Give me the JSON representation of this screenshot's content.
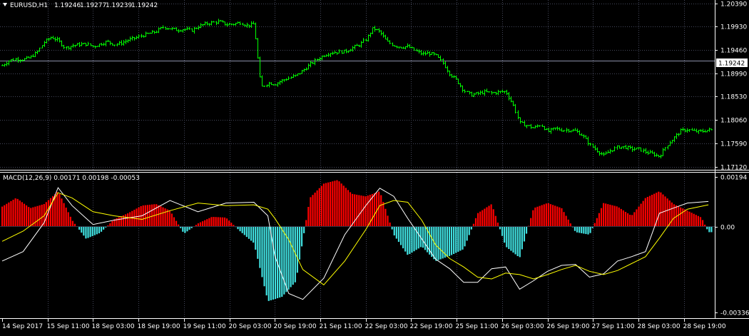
{
  "chart_data": [
    {
      "type": "bar",
      "title": "EURUSD,H1",
      "ohlc": [
        "1.19246",
        "1.19277",
        "1.19239",
        "1.19242"
      ],
      "current_price_label": "1.19242",
      "ylim": [
        1.1712,
        1.2039
      ],
      "y_ticks": [
        "1.20390",
        "1.19930",
        "1.19460",
        "1.18990",
        "1.18530",
        "1.18060",
        "1.17590",
        "1.17120"
      ],
      "colors": {
        "bars": "#00ff00",
        "grid": "#44475a",
        "price_line": "#8a8fa8"
      },
      "price_path": [
        [
          0,
          1.1915
        ],
        [
          1,
          1.1925
        ],
        [
          2,
          1.1928
        ],
        [
          3,
          1.1927
        ],
        [
          4,
          1.1931
        ],
        [
          5,
          1.1942
        ],
        [
          6,
          1.1962
        ],
        [
          7,
          1.1972
        ],
        [
          8,
          1.1965
        ],
        [
          9,
          1.195
        ],
        [
          10,
          1.1955
        ],
        [
          11,
          1.1957
        ],
        [
          12,
          1.1958
        ],
        [
          13,
          1.1953
        ],
        [
          14,
          1.1958
        ],
        [
          15,
          1.1963
        ],
        [
          16,
          1.1957
        ],
        [
          17,
          1.196
        ],
        [
          18,
          1.1966
        ],
        [
          19,
          1.197
        ],
        [
          20,
          1.1975
        ],
        [
          21,
          1.1979
        ],
        [
          22,
          1.1983
        ],
        [
          23,
          1.1992
        ],
        [
          24,
          1.1989
        ],
        [
          25,
          1.1986
        ],
        [
          26,
          1.1988
        ],
        [
          27,
          1.1985
        ],
        [
          28,
          1.1993
        ],
        [
          29,
          1.1998
        ],
        [
          30,
          1.2001
        ],
        [
          31,
          1.2003
        ],
        [
          32,
          1.1997
        ],
        [
          33,
          1.1998
        ],
        [
          34,
          1.2001
        ],
        [
          35,
          1.1995
        ],
        [
          36,
          1.1998
        ],
        [
          37,
          1.1871
        ],
        [
          38,
          1.188
        ],
        [
          39,
          1.1878
        ],
        [
          40,
          1.1885
        ],
        [
          41,
          1.189
        ],
        [
          42,
          1.1895
        ],
        [
          43,
          1.1905
        ],
        [
          44,
          1.1917
        ],
        [
          45,
          1.1927
        ],
        [
          46,
          1.1936
        ],
        [
          47,
          1.1941
        ],
        [
          48,
          1.1942
        ],
        [
          49,
          1.1943
        ],
        [
          50,
          1.195
        ],
        [
          51,
          1.1956
        ],
        [
          52,
          1.1967
        ],
        [
          53,
          1.199
        ],
        [
          54,
          1.1982
        ],
        [
          55,
          1.1963
        ],
        [
          56,
          1.1955
        ],
        [
          57,
          1.1952
        ],
        [
          58,
          1.1953
        ],
        [
          59,
          1.1945
        ],
        [
          60,
          1.1938
        ],
        [
          61,
          1.194
        ],
        [
          62,
          1.1935
        ],
        [
          63,
          1.192
        ],
        [
          64,
          1.1898
        ],
        [
          65,
          1.1885
        ],
        [
          66,
          1.1865
        ],
        [
          67,
          1.1856
        ],
        [
          68,
          1.1859
        ],
        [
          69,
          1.1862
        ],
        [
          70,
          1.186
        ],
        [
          71,
          1.1862
        ],
        [
          72,
          1.1863
        ],
        [
          73,
          1.1838
        ],
        [
          74,
          1.18
        ],
        [
          75,
          1.1795
        ],
        [
          76,
          1.179
        ],
        [
          77,
          1.1797
        ],
        [
          78,
          1.1782
        ],
        [
          79,
          1.1789
        ],
        [
          80,
          1.1786
        ],
        [
          81,
          1.1786
        ],
        [
          82,
          1.1784
        ],
        [
          83,
          1.1775
        ],
        [
          84,
          1.1757
        ],
        [
          85,
          1.1745
        ],
        [
          86,
          1.1735
        ],
        [
          87,
          1.1745
        ],
        [
          88,
          1.1752
        ],
        [
          89,
          1.1752
        ],
        [
          90,
          1.1748
        ],
        [
          91,
          1.1748
        ],
        [
          92,
          1.1742
        ],
        [
          93,
          1.1738
        ],
        [
          94,
          1.1733
        ],
        [
          95,
          1.1755
        ],
        [
          96,
          1.177
        ],
        [
          97,
          1.1784
        ],
        [
          98,
          1.1787
        ],
        [
          99,
          1.1783
        ],
        [
          100,
          1.1783
        ],
        [
          101,
          1.1786
        ]
      ],
      "x": [
        {
          "label": "14 Sep 2017",
          "pos": 0
        },
        {
          "label": "15 Sep 11:00",
          "pos": 6.5
        },
        {
          "label": "18 Sep 03:00",
          "pos": 13.0
        },
        {
          "label": "18 Sep 19:00",
          "pos": 19.5
        },
        {
          "label": "19 Sep 11:00",
          "pos": 26.0
        },
        {
          "label": "20 Sep 03:00",
          "pos": 32.5
        },
        {
          "label": "20 Sep 19:00",
          "pos": 39.0
        },
        {
          "label": "21 Sep 11:00",
          "pos": 45.5
        },
        {
          "label": "22 Sep 03:00",
          "pos": 52.0
        },
        {
          "label": "22 Sep 19:00",
          "pos": 58.5
        },
        {
          "label": "25 Sep 11:00",
          "pos": 65.0
        },
        {
          "label": "26 Sep 03:00",
          "pos": 71.5
        },
        {
          "label": "26 Sep 19:00",
          "pos": 78.0
        },
        {
          "label": "27 Sep 11:00",
          "pos": 84.5
        },
        {
          "label": "28 Sep 03:00",
          "pos": 91.0
        },
        {
          "label": "28 Sep 19:00",
          "pos": 97.5
        }
      ],
      "xlim": [
        0,
        101.5
      ]
    },
    {
      "type": "bar",
      "title": "MACD(12,26,9) 0.00171 0.00198 -0.00053",
      "ylim": [
        -0.00336,
        0.00194
      ],
      "y_ticks": [
        "0.00194",
        "0.00",
        "-0.00336"
      ],
      "colors": {
        "positive": "#ff0000",
        "negative": "#40e0e0",
        "macd_line": "#ffffff",
        "signal_line": "#ffff00"
      },
      "histogram": [
        [
          0,
          0.00078
        ],
        [
          2,
          0.00112
        ],
        [
          4,
          0.00072
        ],
        [
          6,
          0.00088
        ],
        [
          8,
          0.00138
        ],
        [
          10,
          0.00025
        ],
        [
          12,
          -0.00048
        ],
        [
          14,
          -0.00025
        ],
        [
          16,
          0.00028
        ],
        [
          18,
          0.00052
        ],
        [
          20,
          0.00082
        ],
        [
          22,
          0.00088
        ],
        [
          24,
          0.00062
        ],
        [
          26,
          -0.00028
        ],
        [
          28,
          0.00012
        ],
        [
          30,
          0.00038
        ],
        [
          32,
          0.00035
        ],
        [
          34,
          -0.00018
        ],
        [
          36,
          -0.00065
        ],
        [
          38,
          -0.00292
        ],
        [
          40,
          -0.00275
        ],
        [
          42,
          -0.00215
        ],
        [
          44,
          0.00112
        ],
        [
          46,
          0.00168
        ],
        [
          48,
          0.00182
        ],
        [
          50,
          0.00128
        ],
        [
          52,
          0.00118
        ],
        [
          54,
          0.00138
        ],
        [
          56,
          -0.00032
        ],
        [
          58,
          -0.00112
        ],
        [
          60,
          -0.00078
        ],
        [
          62,
          -0.00135
        ],
        [
          64,
          -0.00115
        ],
        [
          66,
          -0.00088
        ],
        [
          68,
          0.00052
        ],
        [
          70,
          0.00088
        ],
        [
          72,
          -0.00078
        ],
        [
          74,
          -0.00122
        ],
        [
          76,
          0.00072
        ],
        [
          78,
          0.00092
        ],
        [
          80,
          0.00072
        ],
        [
          82,
          -0.00022
        ],
        [
          84,
          -0.00032
        ],
        [
          86,
          0.00092
        ],
        [
          88,
          0.00078
        ],
        [
          90,
          0.00042
        ],
        [
          92,
          0.00112
        ],
        [
          94,
          0.00138
        ],
        [
          96,
          0.00088
        ],
        [
          98,
          0.00062
        ],
        [
          100,
          0.00035
        ],
        [
          101,
          -0.00022
        ]
      ],
      "macd": [
        [
          0,
          -0.00135
        ],
        [
          3,
          -0.00098
        ],
        [
          6,
          0.00015
        ],
        [
          8,
          0.00152
        ],
        [
          10,
          0.00082
        ],
        [
          13,
          8e-05
        ],
        [
          16,
          0.00025
        ],
        [
          20,
          0.00042
        ],
        [
          24,
          0.00102
        ],
        [
          28,
          0.00058
        ],
        [
          32,
          0.00092
        ],
        [
          36,
          0.00095
        ],
        [
          38,
          0.00042
        ],
        [
          39,
          -0.00115
        ],
        [
          41,
          -0.00262
        ],
        [
          43,
          -0.00285
        ],
        [
          46,
          -0.00202
        ],
        [
          49,
          -0.00032
        ],
        [
          52,
          0.00082
        ],
        [
          54,
          0.0015
        ],
        [
          56,
          0.00118
        ],
        [
          58,
          0.00032
        ],
        [
          60,
          -0.00048
        ],
        [
          62,
          -0.00128
        ],
        [
          64,
          -0.00165
        ],
        [
          66,
          -0.00218
        ],
        [
          68,
          -0.00218
        ],
        [
          70,
          -0.00165
        ],
        [
          72,
          -0.00158
        ],
        [
          74,
          -0.00245
        ],
        [
          76,
          -0.00212
        ],
        [
          78,
          -0.00175
        ],
        [
          80,
          -0.00152
        ],
        [
          82,
          -0.00148
        ],
        [
          84,
          -0.00198
        ],
        [
          86,
          -0.00185
        ],
        [
          88,
          -0.00135
        ],
        [
          90,
          -0.00118
        ],
        [
          92,
          -0.00098
        ],
        [
          94,
          0.00052
        ],
        [
          96,
          0.00072
        ],
        [
          98,
          0.00092
        ],
        [
          101,
          0.00098
        ]
      ],
      "signal": [
        [
          0,
          -0.00058
        ],
        [
          3,
          -0.00018
        ],
        [
          6,
          0.00042
        ],
        [
          8,
          0.00132
        ],
        [
          10,
          0.00112
        ],
        [
          13,
          0.00058
        ],
        [
          16,
          0.00042
        ],
        [
          20,
          0.00028
        ],
        [
          24,
          0.00062
        ],
        [
          28,
          0.00092
        ],
        [
          32,
          0.00082
        ],
        [
          36,
          0.00085
        ],
        [
          38,
          0.00068
        ],
        [
          39,
          0.00032
        ],
        [
          41,
          -0.00052
        ],
        [
          43,
          -0.00168
        ],
        [
          46,
          -0.00228
        ],
        [
          49,
          -0.00135
        ],
        [
          52,
          -0.00012
        ],
        [
          54,
          0.00082
        ],
        [
          56,
          0.00102
        ],
        [
          58,
          0.00095
        ],
        [
          60,
          0.00025
        ],
        [
          62,
          -0.00072
        ],
        [
          64,
          -0.00125
        ],
        [
          66,
          -0.00158
        ],
        [
          68,
          -0.00198
        ],
        [
          70,
          -0.00205
        ],
        [
          72,
          -0.00182
        ],
        [
          74,
          -0.00188
        ],
        [
          76,
          -0.00205
        ],
        [
          78,
          -0.00188
        ],
        [
          80,
          -0.00168
        ],
        [
          82,
          -0.00152
        ],
        [
          84,
          -0.00175
        ],
        [
          86,
          -0.00188
        ],
        [
          88,
          -0.00172
        ],
        [
          90,
          -0.00145
        ],
        [
          92,
          -0.00118
        ],
        [
          94,
          -0.00045
        ],
        [
          96,
          0.00032
        ],
        [
          98,
          0.00068
        ],
        [
          101,
          0.00085
        ]
      ]
    }
  ]
}
